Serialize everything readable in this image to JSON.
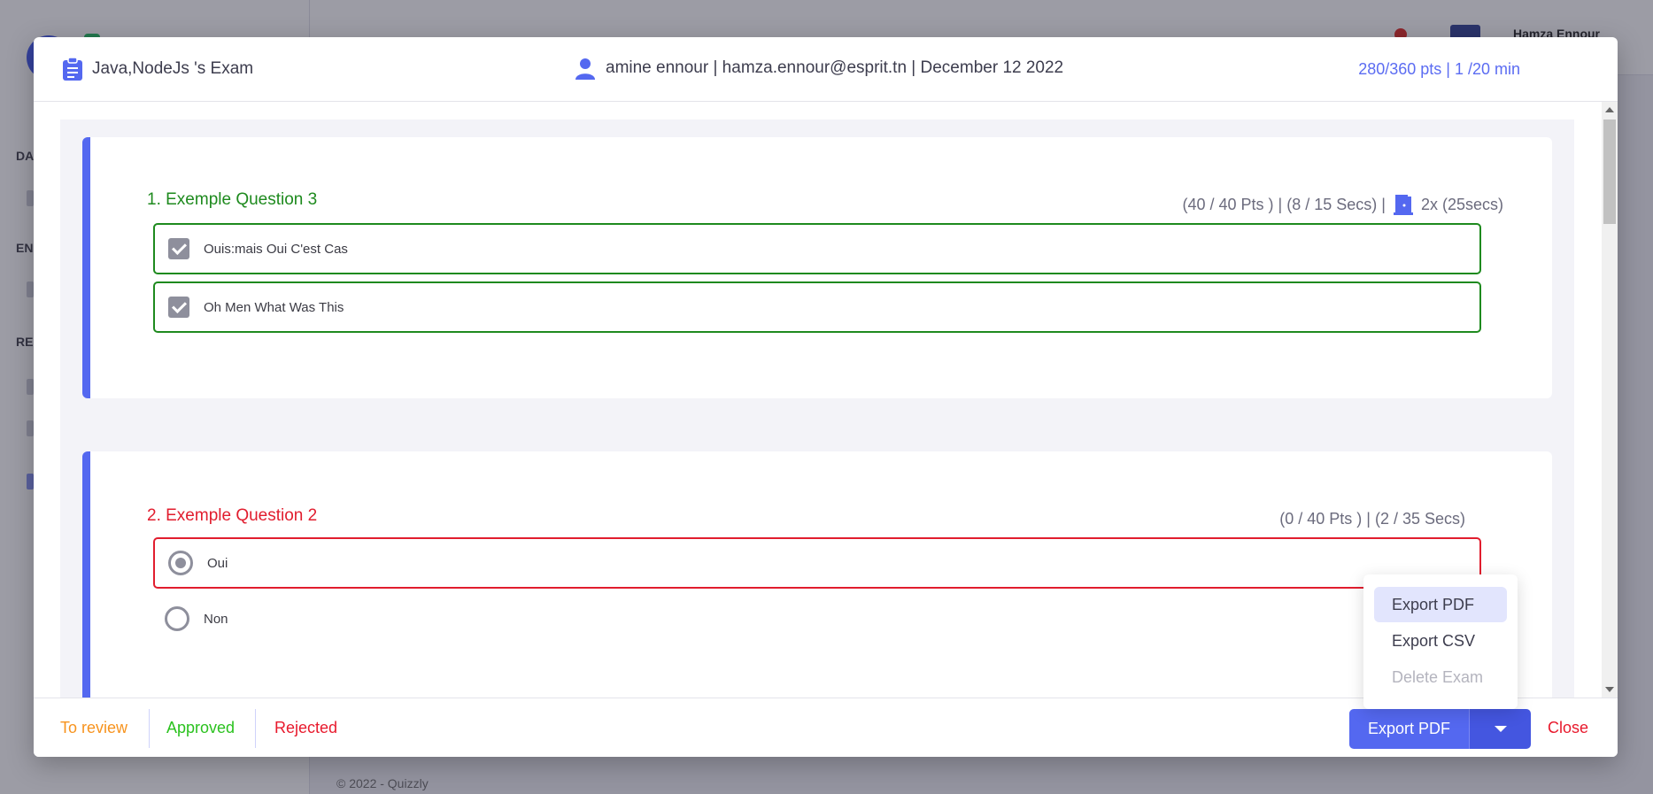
{
  "background": {
    "sidebar_sections": [
      "DA",
      "EN",
      "RE"
    ],
    "user_name": "Hamza Ennour",
    "footer": "© 2022 - Quizzly"
  },
  "header": {
    "exam_title": "Java,NodeJs 's Exam",
    "candidate_info": "amine ennour | hamza.ennour@esprit.tn | December 12 2022",
    "score_info": "280/360 pts | 1 /20 min"
  },
  "questions": [
    {
      "title": "1. Exemple Question 3",
      "status": "correct",
      "meta": "(40 / 40 Pts ) | (8 / 15 Secs) |",
      "exits": "2x (25secs)",
      "options": [
        {
          "label": "Ouis:mais Oui C'est Cas",
          "checked": true
        },
        {
          "label": "Oh Men What Was This",
          "checked": true
        }
      ]
    },
    {
      "title": "2. Exemple Question 2",
      "status": "incorrect",
      "meta": "(0 / 40 Pts ) | (2 / 35 Secs)",
      "options": [
        {
          "label": "Oui",
          "selected": true
        },
        {
          "label": "Non",
          "selected": false
        }
      ]
    }
  ],
  "dropdown": {
    "items": [
      "Export PDF",
      "Export CSV",
      "Delete Exam"
    ]
  },
  "footer": {
    "to_review": "To review",
    "approved": "Approved",
    "rejected": "Rejected",
    "export_label": "Export PDF",
    "close_label": "Close"
  },
  "colors": {
    "accent": "#5468f0",
    "correct": "#1e8a1e",
    "incorrect": "#e11d2e",
    "review": "#f7931e",
    "approved": "#2bc21f"
  },
  "icons": [
    "clipboard-icon",
    "user-icon",
    "door-exit-icon",
    "checkbox-checked-icon",
    "radio-icon",
    "chevron-down-icon"
  ]
}
